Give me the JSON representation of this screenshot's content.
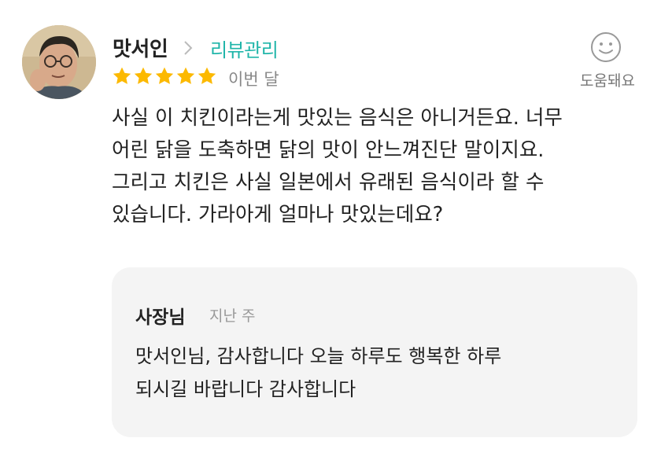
{
  "review": {
    "reviewer_name": "맛서인",
    "manage_link": "리뷰관리",
    "rating": 5,
    "rating_max": 5,
    "date": "이번 달",
    "helpful_label": "도움돼요",
    "text_lines": [
      "사실 이 치킨이라는게 맛있는 음식은 아니거든요. 너무",
      "어린 닭을 도축하면 닭의 맛이 안느껴진단 말이지요.",
      "그리고 치킨은 사실 일본에서 유래된 음식이라 할 수",
      "있습니다. 가라아게 얼마나 맛있는데요?"
    ]
  },
  "reply": {
    "owner_name": "사장님",
    "date": "지난 주",
    "text_lines": [
      "맛서인님, 감사합니다 오늘 하루도 행복한 하루",
      "되시길 바랍니다 감사합니다"
    ]
  },
  "colors": {
    "accent": "#1fb5a9",
    "star": "#fcb900",
    "reply_bg": "#f4f4f4"
  },
  "icons": {
    "avatar": "reviewer-avatar",
    "chevron": "chevron-right-icon",
    "star": "star-icon",
    "helpful": "smile-icon"
  }
}
